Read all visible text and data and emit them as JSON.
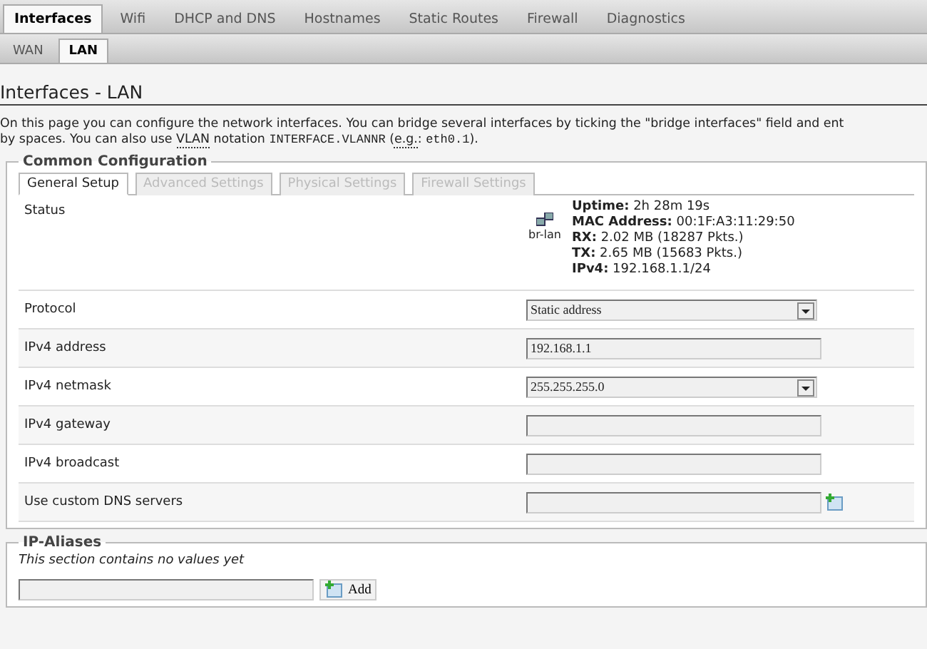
{
  "main_tabs": [
    {
      "label": "Interfaces",
      "selected": true
    },
    {
      "label": "Wifi",
      "selected": false
    },
    {
      "label": "DHCP and DNS",
      "selected": false
    },
    {
      "label": "Hostnames",
      "selected": false
    },
    {
      "label": "Static Routes",
      "selected": false
    },
    {
      "label": "Firewall",
      "selected": false
    },
    {
      "label": "Diagnostics",
      "selected": false
    }
  ],
  "sub_tabs": [
    {
      "label": "WAN",
      "selected": false
    },
    {
      "label": "LAN",
      "selected": true
    }
  ],
  "heading": "Interfaces - LAN",
  "description": [
    [
      {
        "kind": "text",
        "text": "On this page you can configure the network interfaces. You can bridge several interfaces by ticking the \"bridge interfaces\" field and ent"
      }
    ],
    [
      {
        "kind": "text",
        "text": "by spaces. You can also use "
      },
      {
        "kind": "abbr",
        "text": "VLAN"
      },
      {
        "kind": "text",
        "text": " notation "
      },
      {
        "kind": "code",
        "text": "INTERFACE.VLANNR"
      },
      {
        "kind": "text",
        "text": " ("
      },
      {
        "kind": "abbr",
        "text": "e.g."
      },
      {
        "kind": "text",
        "text": ": "
      },
      {
        "kind": "code",
        "text": "eth0.1"
      },
      {
        "kind": "text",
        "text": ")."
      }
    ]
  ],
  "common": {
    "legend": "Common Configuration",
    "tabs": [
      {
        "label": "General Setup",
        "selected": true
      },
      {
        "label": "Advanced Settings",
        "selected": false
      },
      {
        "label": "Physical Settings",
        "selected": false
      },
      {
        "label": "Firewall Settings",
        "selected": false
      }
    ],
    "status": {
      "label": "Status",
      "device": "br-lan",
      "lines": [
        "**Uptime:** 2h 28m 19s",
        "**MAC Address:** 00:1F:A3:11:29:50",
        "**RX:** 2.02 MB (18287 Pkts.)",
        "**TX:** 2.65 MB (15683 Pkts.)",
        "**IPv4:** 192.168.1.1/24"
      ]
    },
    "fields": [
      {
        "label": "Protocol",
        "kind": "select",
        "value": "Static address"
      },
      {
        "label": "IPv4 address",
        "kind": "text",
        "value": "192.168.1.1"
      },
      {
        "label": "IPv4 netmask",
        "kind": "select",
        "value": "255.255.255.0"
      },
      {
        "label": "IPv4 gateway",
        "kind": "text"
      },
      {
        "label": "IPv4 broadcast",
        "kind": "text"
      },
      {
        "label": "Use custom DNS servers",
        "kind": "list"
      }
    ]
  },
  "aliases": {
    "legend": "IP-Aliases",
    "empty_note": "This section contains no values yet",
    "add_button": "Add"
  }
}
